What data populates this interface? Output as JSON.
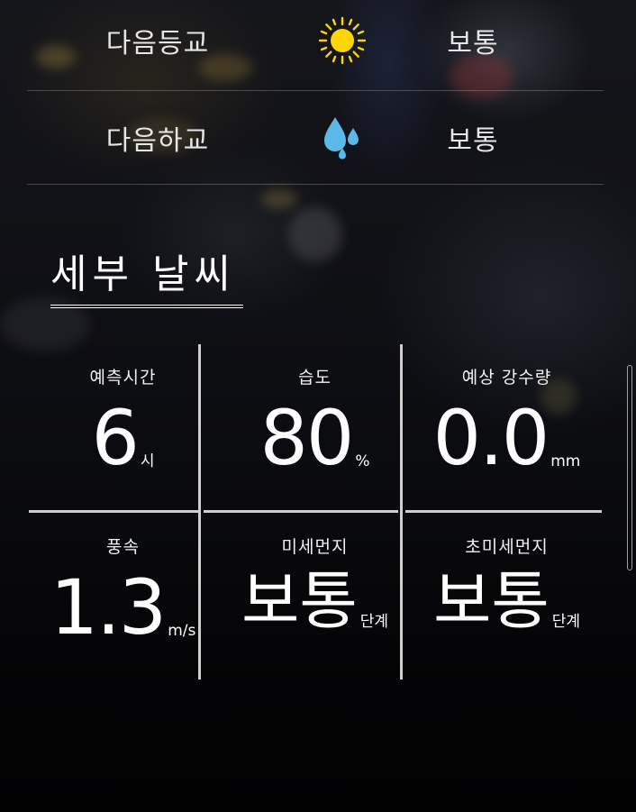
{
  "forecast": {
    "rows": [
      {
        "label": "다음등교",
        "icon": "sun-icon",
        "status": "보통"
      },
      {
        "label": "다음하교",
        "icon": "raindrops-icon",
        "status": "보통"
      }
    ]
  },
  "section": {
    "title": "세부 날씨"
  },
  "details": {
    "cells": [
      {
        "label": "예측시간",
        "value": "6",
        "unit": "시"
      },
      {
        "label": "습도",
        "value": "80",
        "unit": "%"
      },
      {
        "label": "예상 강수량",
        "value": "0.0",
        "unit": "mm"
      },
      {
        "label": "풍속",
        "value": "1.3",
        "unit": "m/s"
      },
      {
        "label": "미세먼지",
        "value": "보통",
        "unit": "단계"
      },
      {
        "label": "초미세먼지",
        "value": "보통",
        "unit": "단계"
      }
    ]
  },
  "colors": {
    "sun": "#FFD500",
    "rain": "#5BB8E8",
    "text": "#FFFFFF",
    "divider": "#CFCFCF"
  }
}
